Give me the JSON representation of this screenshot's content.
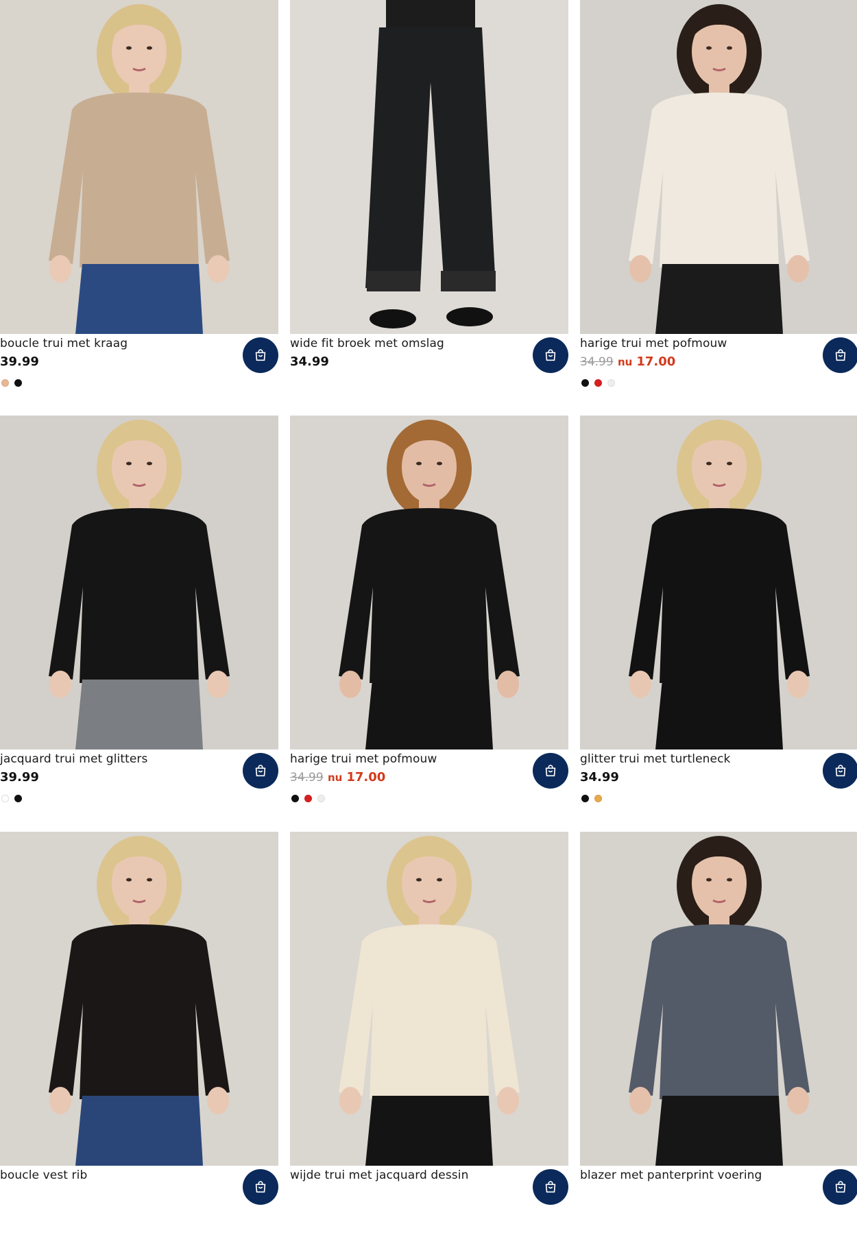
{
  "products": [
    {
      "name": "boucle trui met kraag",
      "price": "39.99",
      "swatches": [
        "#e8b793",
        "#111111"
      ],
      "image": {
        "bg": "#d9d4cc",
        "top": "#c7ad92",
        "bottom": "#2b4a82",
        "skin": "#eac9b5",
        "hair": "#d9c18a"
      }
    },
    {
      "name": "wide fit broek met omslag",
      "price": "34.99",
      "swatches": [],
      "image": {
        "bg": "#dedbd6",
        "top": "#1c1c1c",
        "bottom": "#1e1f21",
        "skin": "#e4c3ad",
        "hair": "#1a1a1a"
      }
    },
    {
      "name": "harige trui met pofmouw",
      "old_price": "34.99",
      "now_label": "nu",
      "now_price": "17.00",
      "swatches": [
        "#111111",
        "#d81f1f",
        "#eeeeee"
      ],
      "image": {
        "bg": "#d4d1cc",
        "top": "#efe9df",
        "bottom": "#1b1b1b",
        "skin": "#e5c1ab",
        "hair": "#2a1e18"
      }
    },
    {
      "name": "jacquard trui met glitters",
      "price": "39.99",
      "swatches": [
        "#ffffff",
        "#111111"
      ],
      "image": {
        "bg": "#d3cfca",
        "top": "#151515",
        "bottom": "#7b7e82",
        "skin": "#e9c8b3",
        "hair": "#dcc48e"
      }
    },
    {
      "name": "harige trui met pofmouw",
      "old_price": "34.99",
      "now_label": "nu",
      "now_price": "17.00",
      "swatches": [
        "#111111",
        "#d81f1f",
        "#eeeeee"
      ],
      "image": {
        "bg": "#d8d5d0",
        "top": "#151515",
        "bottom": "#141414",
        "skin": "#e3bca5",
        "hair": "#a36a35"
      }
    },
    {
      "name": "glitter trui met turtleneck",
      "price": "34.99",
      "swatches": [
        "#111111",
        "#e7a94c"
      ],
      "image": {
        "bg": "#d5d2cd",
        "top": "#121212",
        "bottom": "#121212",
        "skin": "#e8c7b2",
        "hair": "#dcc48e"
      }
    },
    {
      "name": "boucle vest rib",
      "price": "",
      "swatches": [],
      "image": {
        "bg": "#d8d4ce",
        "top": "#1b1716",
        "bottom": "#2a4679",
        "skin": "#e9c8b3",
        "hair": "#dcc48e"
      }
    },
    {
      "name": "wijde trui met jacquard dessin",
      "price": "",
      "swatches": [],
      "image": {
        "bg": "#dad6d0",
        "top": "#efe5d3",
        "bottom": "#141414",
        "skin": "#e9c8b3",
        "hair": "#dcc48e"
      }
    },
    {
      "name": "blazer met panterprint voering",
      "price": "",
      "swatches": [],
      "image": {
        "bg": "#d6d2cc",
        "top": "#535a68",
        "bottom": "#161616",
        "skin": "#e5c1ab",
        "hair": "#2a1e18"
      }
    }
  ],
  "colors": {
    "cart_button": "#0b2a5b",
    "sale": "#d23a1c",
    "old_price": "#9a9a9a"
  },
  "icons": {
    "cart": "shopping-bag-icon"
  }
}
